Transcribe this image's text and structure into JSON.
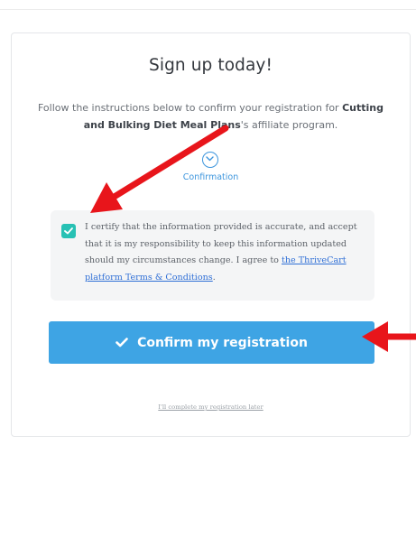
{
  "signup": {
    "title": "Sign up today!",
    "intro_prefix": "Follow the instructions below to confirm your registration for ",
    "product_name": "Cutting and Bulking Diet Meal Plans",
    "intro_suffix": "'s affiliate program."
  },
  "step": {
    "icon": "chevron-down-icon",
    "label": "Confirmation"
  },
  "certify": {
    "checked": true,
    "text": "I certify that the information provided is accurate, and accept that it is my responsibility to keep this information updated should my circumstances change. I agree to ",
    "link_text": "the ThriveCart platform Terms & Conditions",
    "text_end": "."
  },
  "confirm_button": {
    "icon": "check-icon",
    "label": "Confirm my registration"
  },
  "later_link": "I'll complete my registration later",
  "colors": {
    "accent": "#3ea4e4",
    "checkbox": "#27c1b4",
    "link": "#2f6fd6",
    "arrow": "#e8151b"
  }
}
